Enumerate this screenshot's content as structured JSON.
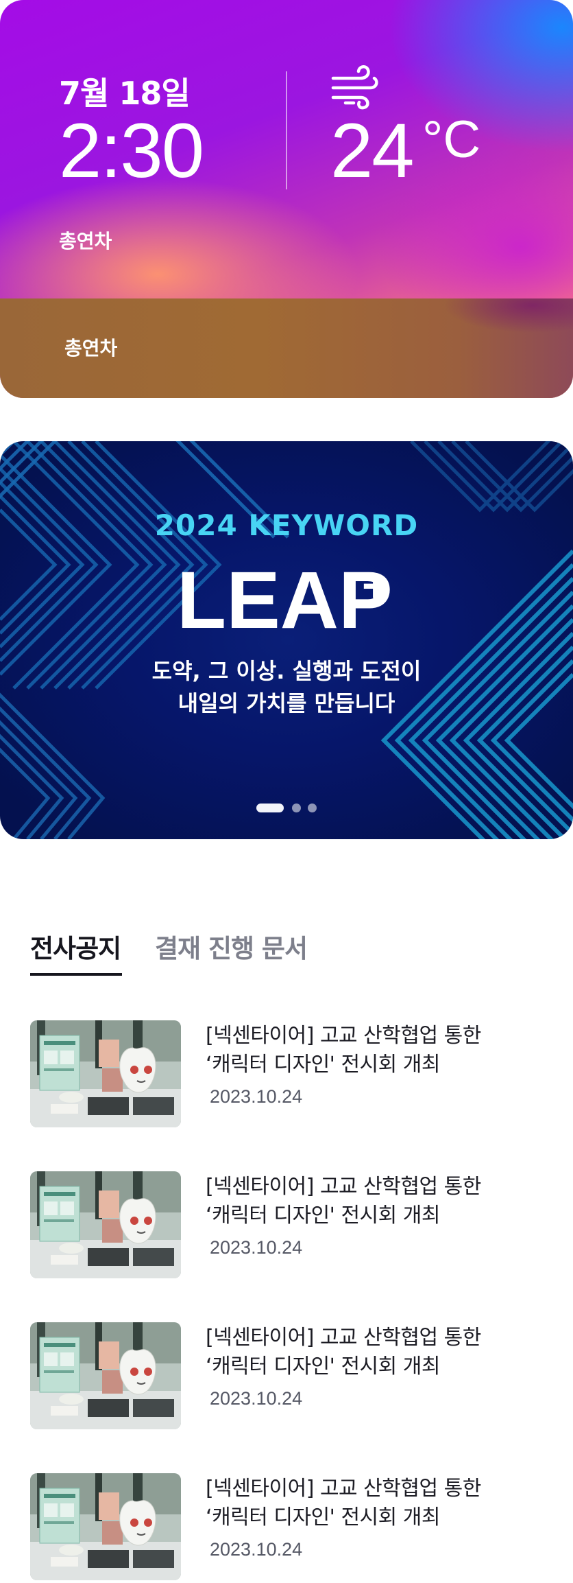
{
  "weather": {
    "date": "7월 18일",
    "time": "2:30",
    "temperature": "24",
    "unit": "°C",
    "label_top": "총연차",
    "label_bottom": "총연차",
    "icon": "wind-icon"
  },
  "banner": {
    "keyword": "2024 KEYWORD",
    "title": "LEAP",
    "title_mark": "+",
    "subtitle_line1": "도약, 그 이상. 실행과 도전이",
    "subtitle_line2": "내일의 가치를 만듭니다",
    "slide_count": 3,
    "active_slide": 1
  },
  "tabs": [
    {
      "label": "전사공지",
      "active": true
    },
    {
      "label": "결재 진행 문서",
      "active": false
    }
  ],
  "news": [
    {
      "title_line1": "[넥센타이어] 고교 산학협업 통한",
      "title_line2": "‘캐릭터 디자인' 전시회 개최",
      "date": "2023.10.24"
    },
    {
      "title_line1": "[넥센타이어] 고교 산학협업 통한",
      "title_line2": "‘캐릭터 디자인' 전시회 개최",
      "date": "2023.10.24"
    },
    {
      "title_line1": "[넥센타이어] 고교 산학협업 통한",
      "title_line2": "‘캐릭터 디자인' 전시회 개최",
      "date": "2023.10.24"
    },
    {
      "title_line1": "[넥센타이어] 고교 산학협업 통한",
      "title_line2": "‘캐릭터 디자인' 전시회 개최",
      "date": "2023.10.24"
    }
  ]
}
